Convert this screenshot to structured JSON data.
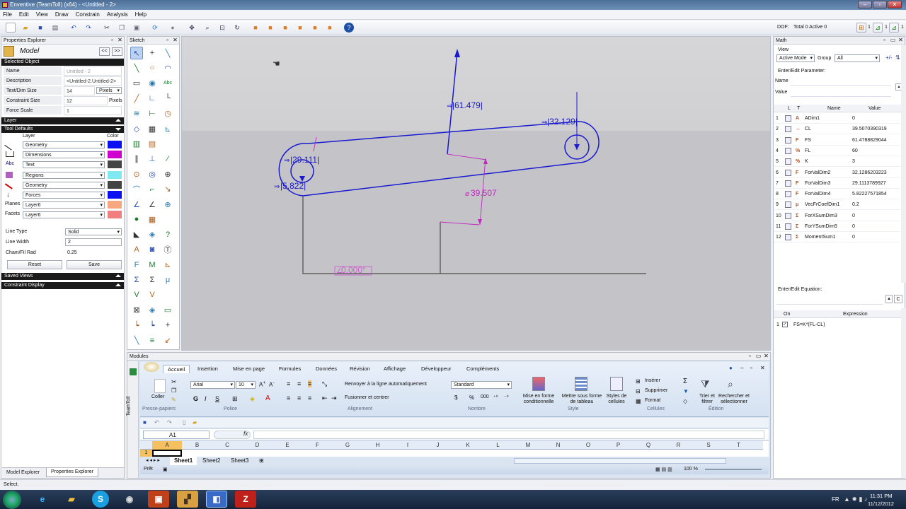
{
  "window": {
    "title": "Enventive (TeamToll) (x64) - <Untitled - 2>"
  },
  "menu": [
    "File",
    "Edit",
    "View",
    "Draw",
    "Constrain",
    "Analysis",
    "Help"
  ],
  "toolbar": {
    "dof_label": "DOF:",
    "dof_value": "Total 0  Active 0",
    "right_counts": [
      "1",
      "1",
      "1"
    ]
  },
  "properties_explorer": {
    "title": "Properties Explorer",
    "model_label": "Model",
    "nav": [
      "<<",
      ">>"
    ],
    "selected_object": {
      "header": "Selected Object",
      "rows": [
        {
          "label": "Name",
          "value": "Untitled - 2"
        },
        {
          "label": "Description",
          "value": "<Untitled-2.Untitled-2>"
        },
        {
          "label": "Text/Dim Size",
          "value": "14",
          "unit": "Pixels"
        },
        {
          "label": "Constraint Size",
          "value": "12",
          "unit": "Pixels"
        },
        {
          "label": "Force Scale",
          "value": "1"
        }
      ]
    },
    "layer_header": "Layer",
    "tool_defaults": {
      "header": "Tool Defaults",
      "col_layer": "Layer",
      "col_color": "Color",
      "rows": [
        {
          "icon": "line-icon",
          "layer": "Geometry",
          "color": "#0a10f0"
        },
        {
          "icon": "dimension-icon",
          "layer": "Dimensions",
          "color": "#d000d0"
        },
        {
          "icon": "text-icon",
          "icon_text": "Abc",
          "layer": "Text",
          "color": "#444444"
        },
        {
          "icon": "region-icon",
          "layer": "Regions",
          "color": "#80e8f0"
        },
        {
          "icon": "geometry-icon",
          "layer": "Geometry",
          "color": "#444444"
        },
        {
          "icon": "force-icon",
          "layer": "Forces",
          "color": "#0a10f0"
        },
        {
          "icon": "",
          "label": "Planes",
          "layer": "Layer6",
          "color": "#f8a880"
        },
        {
          "icon": "",
          "label": "Facets",
          "layer": "Layer6",
          "color": "#f08080"
        }
      ]
    },
    "line_type": {
      "label": "Line Type",
      "value": "Solid"
    },
    "line_width": {
      "label": "Line Width",
      "value": "2"
    },
    "cham_fill": {
      "label": "Cham/Fil Rad",
      "value": "0.25"
    },
    "buttons": {
      "reset": "Reset",
      "save": "Save"
    },
    "saved_views": "Saved Views",
    "constraint_display": "Constraint Display",
    "bottom_tabs": [
      "Model Explorer",
      "Properties Explorer"
    ]
  },
  "sketch": {
    "title": "Sketch"
  },
  "canvas": {
    "dims": [
      {
        "text": "|61.479|",
        "color": "#1a1ad0"
      },
      {
        "text": "|32.129|",
        "color": "#1a1ad0"
      },
      {
        "text": "|29.111|",
        "color": "#1a1ad0"
      },
      {
        "text": "|5.822|",
        "color": "#1a1ad0"
      },
      {
        "text": "39.507",
        "color": "#c028c0"
      },
      {
        "text": "0.000°",
        "color": "#d060d0"
      }
    ]
  },
  "math": {
    "title": "Math",
    "view_label": "View",
    "mode_value": "Active Mode",
    "group_label": "Group",
    "group_value": "All",
    "enter_param_label": "Enter/Edit Parameter:",
    "name_label": "Name",
    "value_label": "Value",
    "cols": [
      "L",
      "T",
      "Name",
      "Value"
    ],
    "params": [
      {
        "n": "1",
        "t": "A",
        "name": "ADim1",
        "value": "0"
      },
      {
        "n": "2",
        "t": "↔",
        "name": "CL",
        "value": "39.5070390319"
      },
      {
        "n": "3",
        "t": "F",
        "name": "FS",
        "value": "61.4788829044"
      },
      {
        "n": "4",
        "t": "%",
        "name": "FL",
        "value": "60"
      },
      {
        "n": "5",
        "t": "%",
        "name": "K",
        "value": "3"
      },
      {
        "n": "6",
        "t": "F",
        "name": "ForValDim2",
        "value": "32.1286203223"
      },
      {
        "n": "7",
        "t": "F",
        "name": "ForValDim3",
        "value": "29.1113789927"
      },
      {
        "n": "8",
        "t": "F",
        "name": "ForValDim4",
        "value": "5.82227571854"
      },
      {
        "n": "9",
        "t": "μ",
        "name": "VecFrCoefDim1",
        "value": "0.2"
      },
      {
        "n": "10",
        "t": "Σ",
        "name": "ForXSumDim3",
        "value": "0"
      },
      {
        "n": "11",
        "t": "Σ",
        "name": "ForYSumDim5",
        "value": "0"
      },
      {
        "n": "12",
        "t": "Σ",
        "name": "MomentSum1",
        "value": "0"
      }
    ],
    "enter_eq_label": "Enter/Edit Equation:",
    "eq_btn": "C",
    "eq_cols": [
      "On",
      "Expression"
    ],
    "equations": [
      {
        "n": "1",
        "expr": "FS=K*(FL-CL)"
      }
    ]
  },
  "modules": {
    "title": "Modules",
    "side_tab": "TeamToll",
    "tabs": [
      "Accueil",
      "Insertion",
      "Mise en page",
      "Formules",
      "Données",
      "Révision",
      "Affichage",
      "Développeur",
      "Compléments"
    ],
    "paste_label": "Coller",
    "font_name": "Arial",
    "font_size": "10",
    "wrap_label": "Renvoyer à la ligne automatiquement",
    "merge_label": "Fusionner et centrer",
    "number_format": "Standard",
    "cond_format": "Mise en forme conditionnelle",
    "table_format": "Mettre sous forme de tableau",
    "cell_styles": "Styles de cellules",
    "insert": "Insérer",
    "delete": "Supprimer",
    "format": "Format",
    "sort_filter": "Trier et filtrer",
    "find_select": "Rechercher et sélectionner",
    "groups": [
      "Presse-papiers",
      "Police",
      "Alignement",
      "Nombre",
      "Style",
      "Cellules",
      "Édition"
    ],
    "name_box": "A1",
    "columns": [
      "A",
      "B",
      "C",
      "D",
      "E",
      "F",
      "G",
      "H",
      "I",
      "J",
      "K",
      "L",
      "M",
      "N",
      "O",
      "P",
      "Q",
      "R",
      "S",
      "T"
    ],
    "row1": "1",
    "sheets": [
      "Sheet1",
      "Sheet2",
      "Sheet3"
    ],
    "status": "Prêt",
    "zoom": "100 %"
  },
  "statusbar": {
    "text": "Select."
  },
  "taskbar": {
    "lang": "FR",
    "time": "11:31 PM",
    "date": "11/12/2012"
  }
}
